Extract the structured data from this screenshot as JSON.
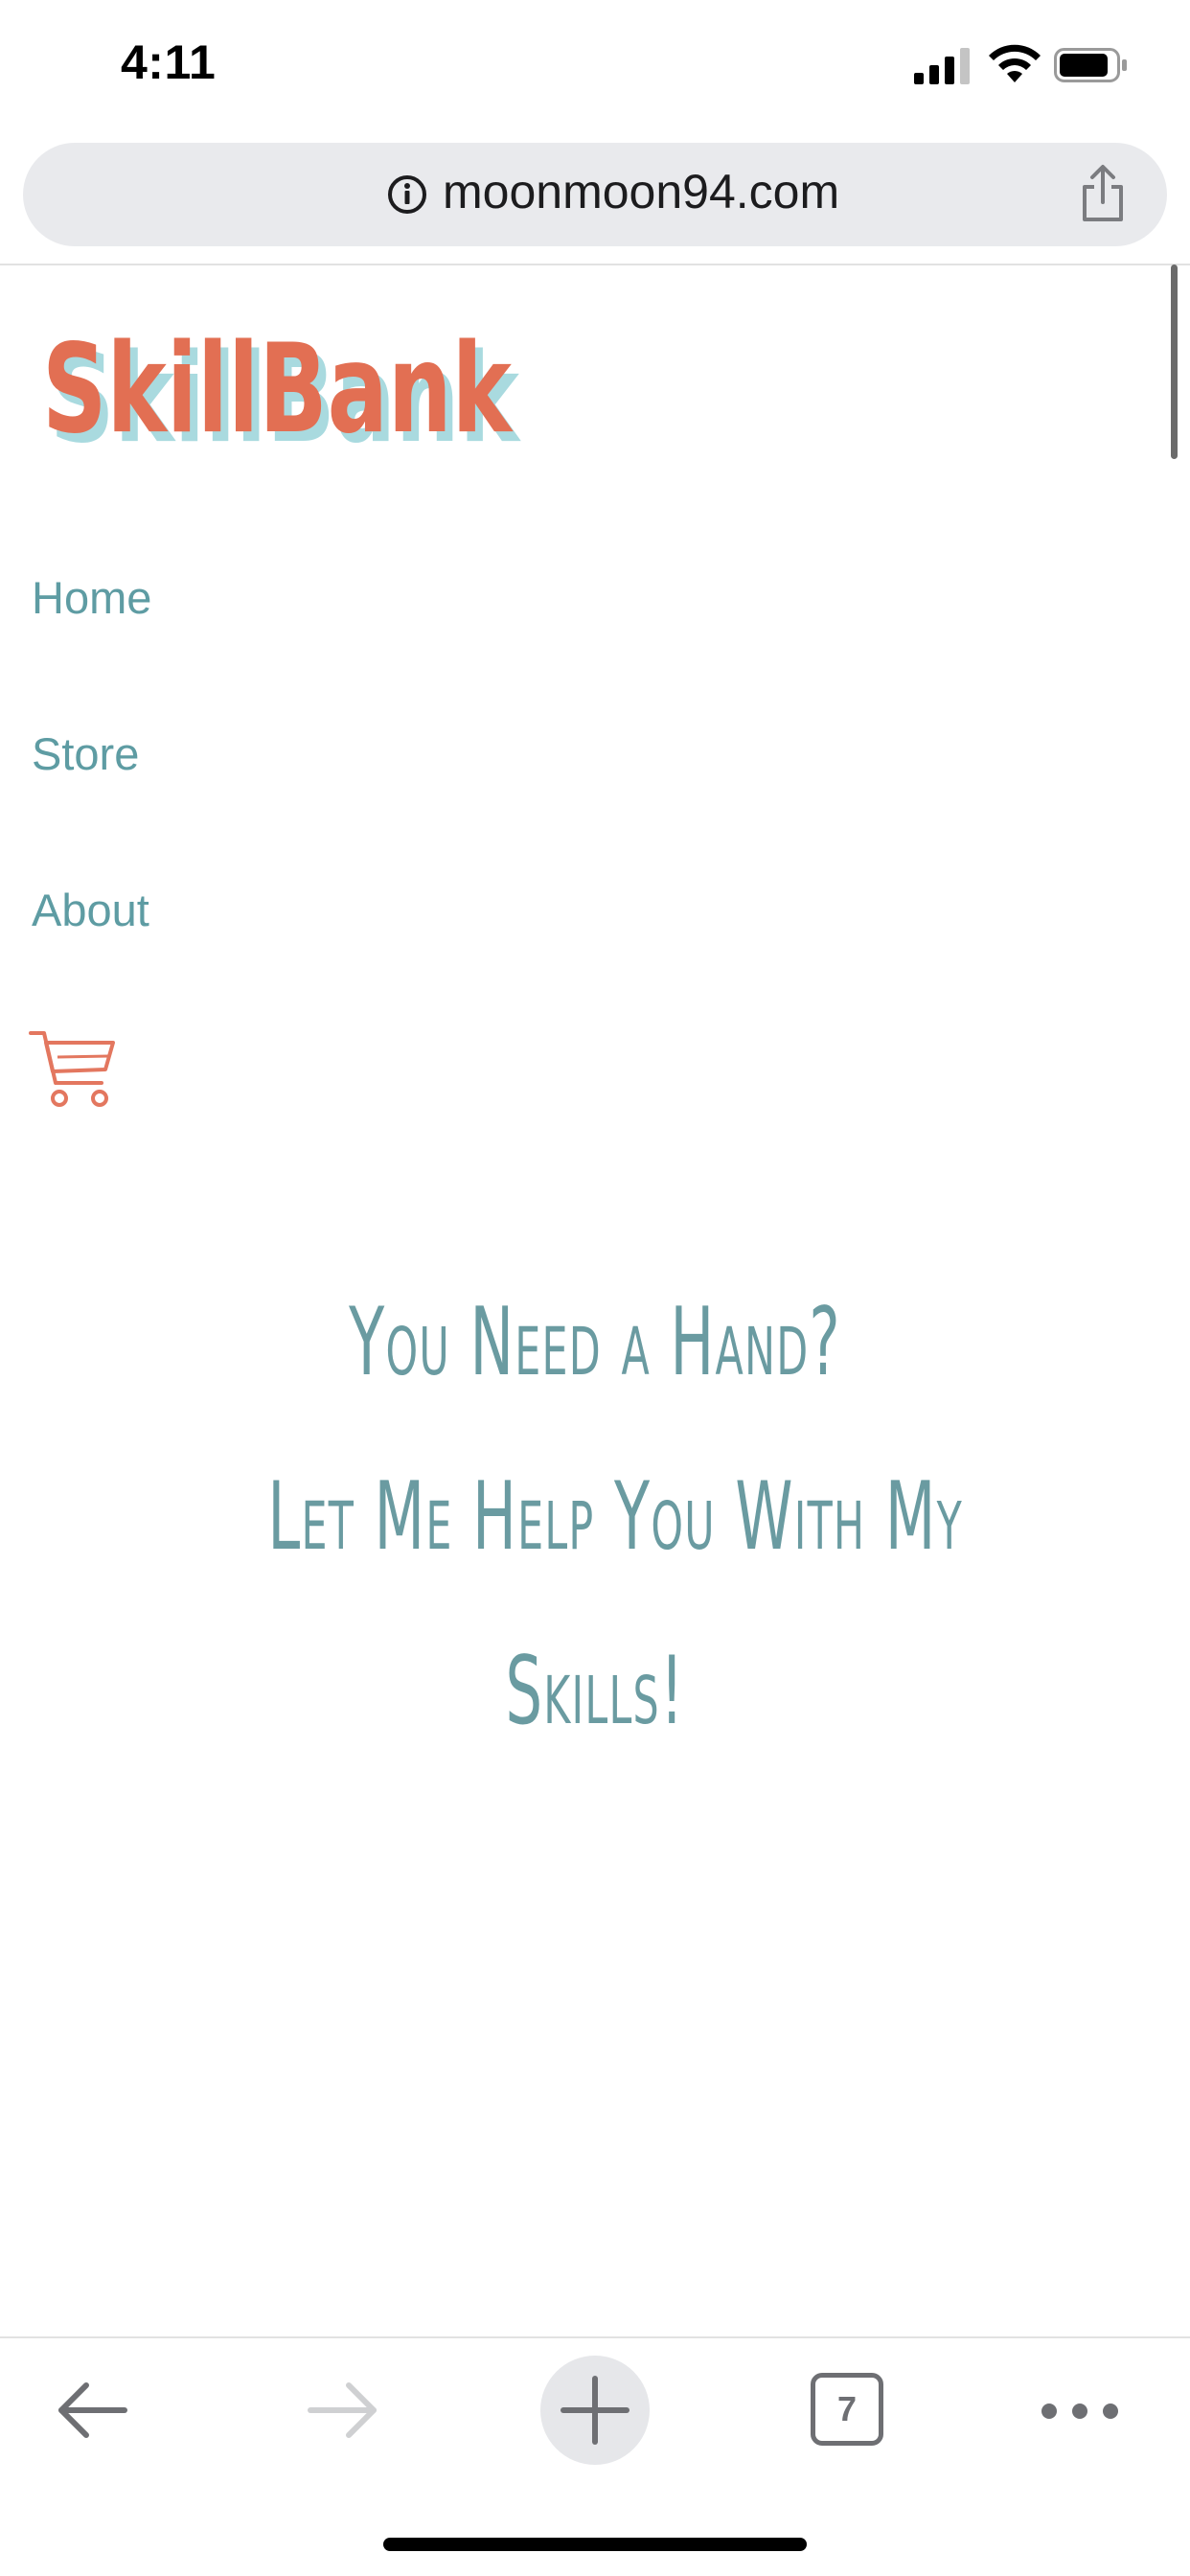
{
  "status_bar": {
    "time": "4:11"
  },
  "browser": {
    "url": "moonmoon94.com",
    "tab_count": "7"
  },
  "site": {
    "logo_text": "SkillBank",
    "nav": [
      {
        "label": "Home"
      },
      {
        "label": "Store"
      },
      {
        "label": "About"
      }
    ],
    "cart_icon": "shopping-cart-icon",
    "hero": {
      "lines": [
        "You Need a Hand?",
        "Let Me Help You With My",
        "Skills!"
      ]
    }
  },
  "colors": {
    "link": "#5e9ca3",
    "hero_text": "#6a9ba1",
    "logo_fill": "#e26f53",
    "logo_shadow": "#a9dadf",
    "cart": "#e3775f"
  }
}
